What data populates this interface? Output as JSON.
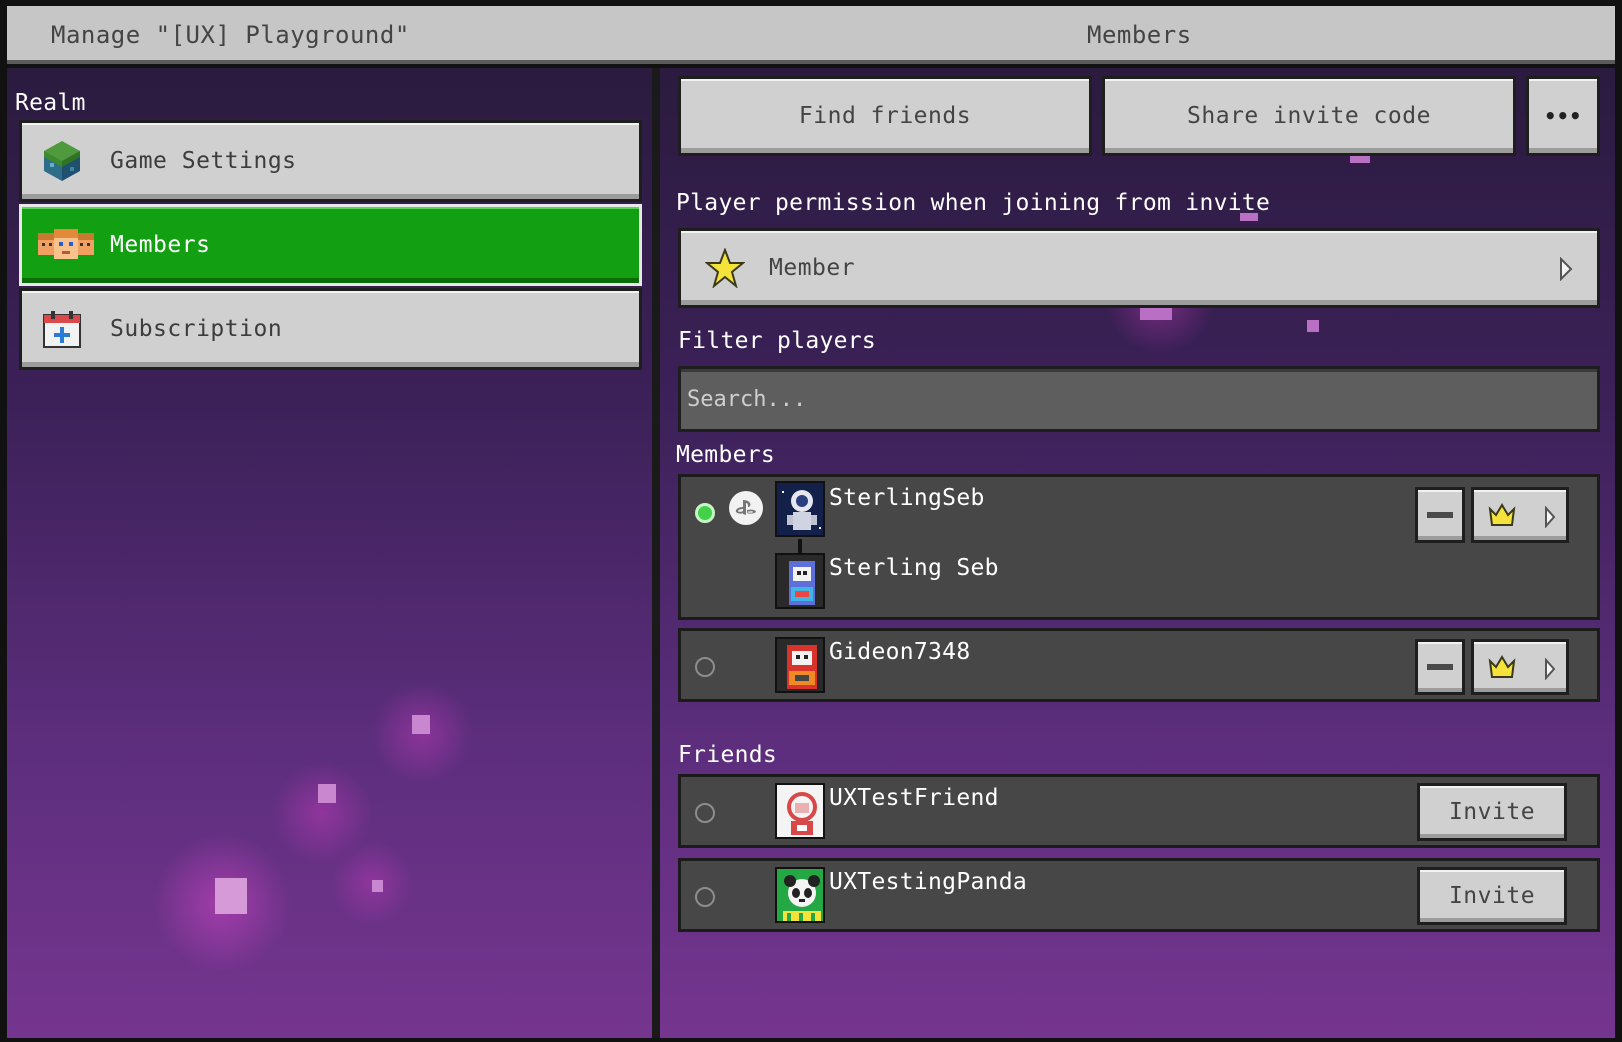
{
  "titlebar": {
    "left_title": "Manage \"[UX] Playground\"",
    "right_title": "Members"
  },
  "sidebar": {
    "section_label": "Realm",
    "items": [
      {
        "label": "Game Settings",
        "icon": "grass-block-icon",
        "active": false
      },
      {
        "label": "Members",
        "icon": "members-icon",
        "active": true
      },
      {
        "label": "Subscription",
        "icon": "calendar-icon",
        "active": false
      }
    ]
  },
  "toolbar": {
    "find_friends_label": "Find friends",
    "share_invite_label": "Share invite code",
    "more_label": "•••"
  },
  "permission": {
    "section_label": "Player permission when joining from invite",
    "value": "Member",
    "icon": "star-icon"
  },
  "filter": {
    "section_label": "Filter players",
    "placeholder": "Search..."
  },
  "members": {
    "section_label": "Members",
    "rows": [
      {
        "name": "SterlingSeb",
        "secondary_name": "Sterling Seb",
        "online": true,
        "platform_icon": "playstation-icon"
      },
      {
        "name": "Gideon7348",
        "online": false
      }
    ]
  },
  "friends": {
    "section_label": "Friends",
    "invite_label": "Invite",
    "rows": [
      {
        "name": "UXTestFriend",
        "online": false
      },
      {
        "name": "UXTestingPanda",
        "online": false
      }
    ]
  },
  "colors": {
    "accent_green": "#12a012",
    "online_green": "#41d24a",
    "button_gray": "#d0d0d0",
    "row_gray": "#474747"
  }
}
